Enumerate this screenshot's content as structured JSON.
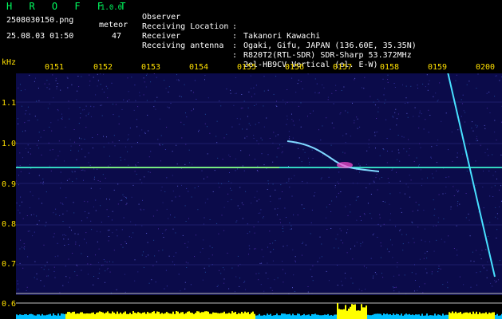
{
  "app": {
    "name": "H R O F F T",
    "version": "1.0.0"
  },
  "file": {
    "name": "2508030150.png",
    "datetime": "25.08.03 01:50"
  },
  "meteor": {
    "label": "meteor",
    "count": "47"
  },
  "info": [
    {
      "label": "Observer",
      "value": "Takanori Kawachi"
    },
    {
      "label": "Receiving Location",
      "value": "Ogaki, Gifu, JAPAN (136.60E, 35.35N)"
    },
    {
      "label": "Receiver",
      "value": "R820T2(RTL-SDR) SDR-Sharp 53.372MHz"
    },
    {
      "label": "Receiving antenna",
      "value": "2el-HB9CV Vertical (el. E-W)"
    }
  ],
  "axis": {
    "unit": "kHz",
    "time_ticks": [
      "0151",
      "0152",
      "0153",
      "0154",
      "0155",
      "0156",
      "0157",
      "0158",
      "0159",
      "0200"
    ],
    "freq_ticks": [
      "1.1",
      "1.0",
      "0.9",
      "0.8",
      "0.7",
      "0.6"
    ]
  },
  "colors": {
    "background": "#0b0b4a",
    "carrier": "#33d6c0",
    "meteor_trail": "#7fd8ff",
    "tick_label": "#ffe000",
    "power_low": "#00bfff",
    "power_high": "#ffff00"
  }
}
